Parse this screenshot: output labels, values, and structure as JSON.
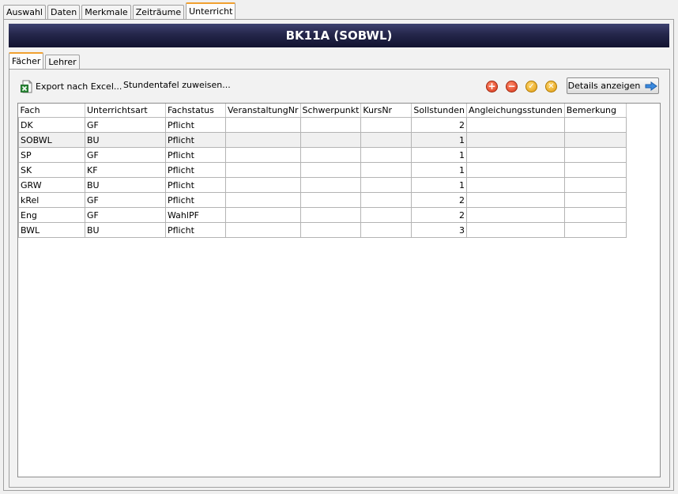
{
  "top_tabs": [
    {
      "label": "Auswahl"
    },
    {
      "label": "Daten"
    },
    {
      "label": "Merkmale"
    },
    {
      "label": "Zeiträume"
    },
    {
      "label": "Unterricht",
      "active": true
    }
  ],
  "title": "BK11A (SOBWL)",
  "sub_tabs": [
    {
      "label": "Fächer",
      "active": true
    },
    {
      "label": "Lehrer"
    }
  ],
  "toolbar": {
    "export_label": "Export nach Excel...",
    "stundentafel_label": "Stundentafel zuweisen...",
    "details_label": "Details anzeigen",
    "icons": [
      "add-icon",
      "remove-icon",
      "confirm-icon",
      "cancel-icon"
    ]
  },
  "grid": {
    "columns": [
      "Fach",
      "Unterrichtsart",
      "Fachstatus",
      "VeranstaltungNr",
      "Schwerpunkt",
      "KursNr",
      "Sollstunden",
      "Angleichungsstunden",
      "Bemerkung"
    ],
    "rows": [
      [
        "DK",
        "GF",
        "Pflicht",
        "",
        "",
        "",
        "2",
        "",
        ""
      ],
      [
        "SOBWL",
        "BU",
        "Pflicht",
        "",
        "",
        "",
        "1",
        "",
        ""
      ],
      [
        "SP",
        "GF",
        "Pflicht",
        "",
        "",
        "",
        "1",
        "",
        ""
      ],
      [
        "SK",
        "KF",
        "Pflicht",
        "",
        "",
        "",
        "1",
        "",
        ""
      ],
      [
        "GRW",
        "BU",
        "Pflicht",
        "",
        "",
        "",
        "1",
        "",
        ""
      ],
      [
        "kRel",
        "GF",
        "Pflicht",
        "",
        "",
        "",
        "2",
        "",
        ""
      ],
      [
        "Eng",
        "GF",
        "WahlPF",
        "",
        "",
        "",
        "2",
        "",
        ""
      ],
      [
        "BWL",
        "BU",
        "Pflicht",
        "",
        "",
        "",
        "3",
        "",
        ""
      ]
    ]
  },
  "colors": {
    "title_bar": "#24264a",
    "active_tab_accent": "#f0a030",
    "add_icon": "#e04a2a",
    "remove_icon": "#e04a2a",
    "confirm_icon": "#e8a020",
    "cancel_icon": "#e8a020",
    "arrow_icon": "#3a8ae0",
    "excel_icon": "#2e8b3a"
  }
}
